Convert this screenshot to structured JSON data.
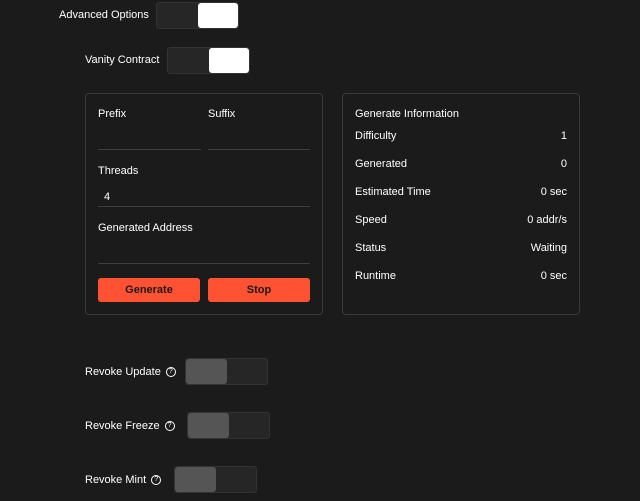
{
  "advanced_options": {
    "label": "Advanced Options",
    "enabled": true
  },
  "vanity_contract": {
    "label": "Vanity Contract",
    "enabled": true
  },
  "generator": {
    "prefix": {
      "label": "Prefix",
      "value": ""
    },
    "suffix": {
      "label": "Suffix",
      "value": ""
    },
    "threads": {
      "label": "Threads",
      "value": "4"
    },
    "generated_address": {
      "label": "Generated Address",
      "value": ""
    },
    "generate_button": "Generate",
    "stop_button": "Stop"
  },
  "info": {
    "title": "Generate Information",
    "rows": [
      {
        "key": "Difficulty",
        "value": "1"
      },
      {
        "key": "Generated",
        "value": "0"
      },
      {
        "key": "Estimated Time",
        "value": "0 sec"
      },
      {
        "key": "Speed",
        "value": "0 addr/s"
      },
      {
        "key": "Status",
        "value": "Waiting"
      },
      {
        "key": "Runtime",
        "value": "0 sec"
      }
    ]
  },
  "revoke_update": {
    "label": "Revoke Update",
    "enabled": false
  },
  "revoke_freeze": {
    "label": "Revoke Freeze",
    "enabled": false
  },
  "revoke_mint": {
    "label": "Revoke Mint",
    "enabled": false
  },
  "help_icon_glyph": "?",
  "colors": {
    "accent": "#ff5233",
    "background": "#1b1b1b",
    "toggle_on": "#ffffff",
    "toggle_off": "#555555"
  }
}
